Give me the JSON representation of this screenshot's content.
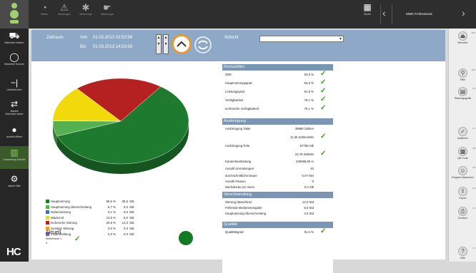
{
  "left_sidebar": {
    "items": [
      {
        "label": "Maschine wählen",
        "icon": "truck-icon"
      },
      {
        "label": "Maschine Sonnen",
        "icon": "power-icon"
      },
      {
        "label": "Unterbrechen",
        "icon": "pause-bar-icon"
      },
      {
        "label": "Bauteil",
        "icon": "transfer-icon"
      },
      {
        "label": "Nachricht sicher",
        "icon": "message-icon"
      },
      {
        "label": "Ansicht öffnen",
        "icon": "circle-icon"
      },
      {
        "label": "Auswertung Schicht",
        "icon": "chart-icon"
      },
      {
        "label": "aktive Hilfe",
        "icon": "gear-icon"
      }
    ],
    "logo": "HC"
  },
  "top_toolbar": {
    "items": [
      {
        "label": "Status",
        "icon": "clock-icon"
      },
      {
        "label": "Meldungen",
        "icon": "warning-icon"
      },
      {
        "label": "Werkzeuge",
        "icon": "tool-icon"
      },
      {
        "label": "Werkzeuge",
        "icon": "hand-icon"
      }
    ],
    "right_button": "Bereit",
    "machine": "MME Professional"
  },
  "filter": {
    "zeitraum_label": "Zeitraum",
    "von_label": "Von",
    "bis_label": "Bis",
    "von_value": "01.03.2013 02:53:58",
    "bis_value": "01.03.2013 14:53:58",
    "schicht_label": "Schicht",
    "schicht_value": ""
  },
  "chart_data": {
    "type": "pie",
    "categories": [
      "Hauptnutzung",
      "Hauptnutzung Überschreitung",
      "Nebennutzung",
      "Wartezeit",
      "technische Störung",
      "sonstige Störung",
      "Instandhaltung"
    ],
    "values": [
      58.6,
      5.7,
      0.1,
      13.5,
      20.9,
      0.0,
      0.0
    ],
    "colors": [
      "#1e7a2e",
      "#55b050",
      "#3d6eb0",
      "#f2d90c",
      "#b52020",
      "#f09b20",
      "#7a5aa8"
    ]
  },
  "legend": [
    {
      "name": "Hauptnutzung",
      "pct": "58,6 %",
      "hours": "35,5",
      "unit": "Std"
    },
    {
      "name": "Hauptnutzung Überschreitung",
      "pct": "5,7 %",
      "hours": "3,0",
      "unit": "Std"
    },
    {
      "name": "Nebennutzung",
      "pct": "0,1 %",
      "hours": "0,0",
      "unit": "Std"
    },
    {
      "name": "Wartezeit",
      "pct": "13,5 %",
      "hours": "8,0",
      "unit": "Std"
    },
    {
      "name": "technische Störung",
      "pct": "20,9 %",
      "hours": "12,0",
      "unit": "Std"
    },
    {
      "name": "sonstige Störung",
      "pct": "0,0 %",
      "hours": "0,0",
      "unit": "Std"
    },
    {
      "name": "Instandhaltung",
      "pct": "0,0 %",
      "hours": "0,0",
      "unit": "Std"
    }
  ],
  "aktuell": {
    "title": "Aktuell",
    "line1": "Betriebsart 1",
    "line2": "0"
  },
  "kennzahlen": {
    "title": "Kennzahlen",
    "rows": [
      {
        "label": "OEE",
        "value": "53,6 %"
      },
      {
        "label": "Hauptnutzungsgrad",
        "value": "63,6 %"
      },
      {
        "label": "Leistungsgrad",
        "value": "91,9 %"
      },
      {
        "label": "Verfügbarkeit",
        "value": "79,1 %"
      },
      {
        "label": "technische Verfügbarkeit",
        "value": "79,1 %"
      }
    ]
  },
  "ausbringung": {
    "title": "Ausbringung",
    "rows": [
      {
        "label": "Ausbringung Takte",
        "value": "39890 Zahlen"
      },
      {
        "label": "",
        "value": "11,35 Zahlen/Min"
      },
      {
        "label": "Ausbringung Teile",
        "value": "57785 Stk"
      },
      {
        "label": "",
        "value": "16,79 Stk/Min"
      },
      {
        "label": "Kantenbearbeitung",
        "value": "239096,00 m"
      },
      {
        "label": "Anzahl Umrüstungen",
        "value": "40"
      },
      {
        "label": "durchschnittliche Dauer",
        "value": "0,07 Min"
      },
      {
        "label": "Anzahl Pausen",
        "value": "0"
      },
      {
        "label": "Werkstücke pro Serie",
        "value": "0,0 Stk"
      }
    ]
  },
  "verschwendung": {
    "title": "Verschwendung",
    "rows": [
      {
        "label": "Störung (Maschine)",
        "value": "12,0 Std"
      },
      {
        "label": "Fehlende Bedienereingabe",
        "value": "8,0 Std"
      },
      {
        "label": "Hauptnutzung Überschreitung",
        "value": "3,0 Std"
      }
    ]
  },
  "qualitaet": {
    "title": "Qualität",
    "rows": [
      {
        "label": "Qualitätsgrad",
        "value": "91,6 %"
      }
    ]
  },
  "right_sidebar": {
    "items": [
      {
        "label": "Beenden",
        "key": "F10",
        "icon": "exit-icon"
      },
      {
        "label": "Filter",
        "key": "F10",
        "icon": "filter-icon"
      },
      {
        "label": "Startungsgrafik",
        "key": "F9",
        "icon": "calendar-icon"
      },
      {
        "label": "Quittieren",
        "key": "F7",
        "icon": "check-icon"
      },
      {
        "label": "QR-Code",
        "key": "F6",
        "icon": "qr-icon"
      },
      {
        "label": "Eingabe Maschinen",
        "key": "F5",
        "icon": "people-icon"
      },
      {
        "label": "Export",
        "key": "F4",
        "icon": "export-icon"
      },
      {
        "label": "Drucken",
        "key": "F3",
        "icon": "printer-icon"
      },
      {
        "label": "Hilfe",
        "key": "F1",
        "icon": "help-icon"
      }
    ]
  }
}
